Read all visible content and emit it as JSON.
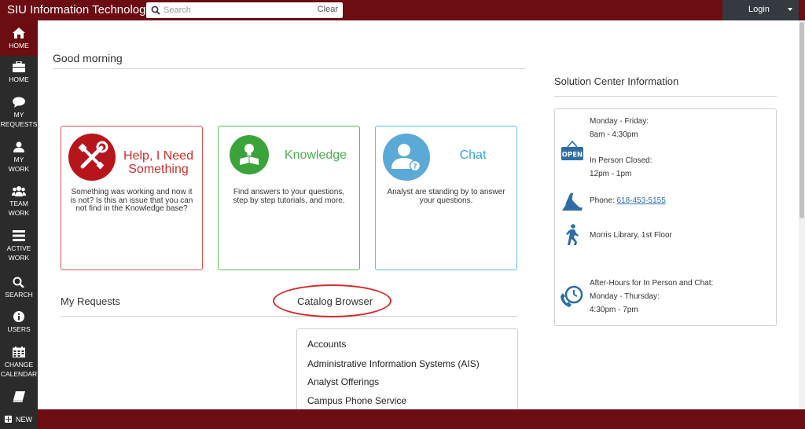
{
  "header": {
    "brand": "SIU Information Technology",
    "search_placeholder": "Search",
    "search_value": "",
    "clear_label": "Clear",
    "login_label": "Login"
  },
  "sidebar": {
    "items": [
      {
        "label": "HOME",
        "icon": "home-icon"
      },
      {
        "label": "HOME",
        "icon": "briefcase-icon"
      },
      {
        "label": "MY REQUESTS",
        "line1": "MY",
        "line2": "REQUESTS",
        "icon": "chat-bubble-icon"
      },
      {
        "label": "MY WORK",
        "line1": "MY",
        "line2": "WORK",
        "icon": "user-icon"
      },
      {
        "label": "TEAM WORK",
        "line1": "TEAM",
        "line2": "WORK",
        "icon": "team-icon"
      },
      {
        "label": "ACTIVE WORK",
        "line1": "ACTIVE",
        "line2": "WORK",
        "icon": "list-icon"
      },
      {
        "label": "SEARCH",
        "icon": "search-icon"
      },
      {
        "label": "USERS",
        "icon": "info-icon"
      },
      {
        "label": "CHANGE CALENDAR",
        "line1": "CHANGE",
        "line2": "CALENDAR",
        "icon": "calendar-icon"
      },
      {
        "label": "",
        "icon": "book-icon"
      }
    ],
    "new_label": "NEW"
  },
  "main": {
    "greeting": "Good morning",
    "tiles": [
      {
        "title_line1": "Help, I Need",
        "title_line2": "Something",
        "description": "Something was working and now it is not? Is this an issue that you can not find in the Knowledge base?",
        "color": "#c9302c",
        "icon": "tools-icon"
      },
      {
        "title": "Knowledge",
        "description": "Find answers to your questions, step by step tutorials, and more.",
        "color": "#4cae4c",
        "icon": "lightbulb-book-icon"
      },
      {
        "title": "Chat",
        "description": "Analyst are standing by to answer your questions.",
        "color": "#31a5d8",
        "icon": "user-question-icon"
      }
    ],
    "my_requests_title": "My Requests",
    "catalog_title": "Catalog Browser",
    "catalog_items": [
      "Accounts",
      "Administrative Information Systems (AIS)",
      "Analyst Offerings",
      "Campus Phone Service"
    ]
  },
  "solution_center": {
    "title": "Solution Center Information",
    "hours_line1": "Monday - Friday:",
    "hours_line2": "8am - 4:30pm",
    "closed_line1": "In Person Closed:",
    "closed_line2": "12pm - 1pm",
    "phone_label": "Phone: ",
    "phone_number": "618-453-5155",
    "location": "Morris Library, 1st Floor",
    "after_hours_line1": "After-Hours for In Person and Chat:",
    "after_hours_line2": "Monday - Thursday:",
    "after_hours_line3": "4:30pm - 7pm",
    "open_sign": "OPEN"
  },
  "colors": {
    "brand": "#6b0d12",
    "nav_bg": "#2b2b2b",
    "help": "#c9302c",
    "knowledge": "#4cae4c",
    "chat": "#31a5d8",
    "link": "#2a6fb0"
  }
}
